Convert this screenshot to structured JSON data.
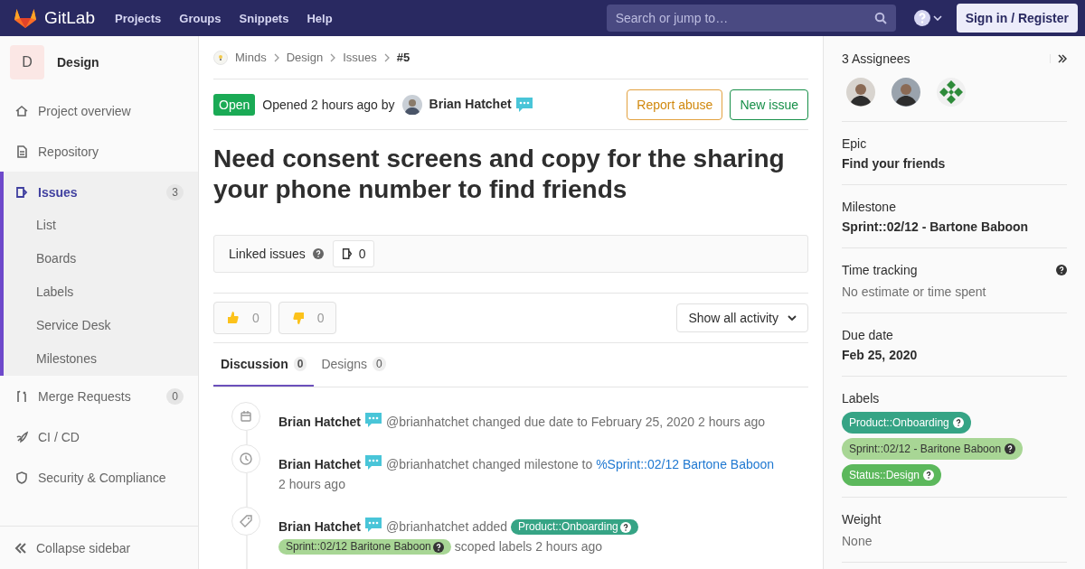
{
  "header": {
    "logo_text": "GitLab",
    "nav": [
      "Projects",
      "Groups",
      "Snippets",
      "Help"
    ],
    "search": {
      "placeholder": "Search or jump to…"
    },
    "sign_in": "Sign in / Register"
  },
  "sidebar": {
    "project_letter": "D",
    "project_name": "Design",
    "items": [
      {
        "label": "Project overview",
        "selected": false
      },
      {
        "label": "Repository",
        "selected": false
      },
      {
        "label": "Issues",
        "selected": true,
        "count": "3",
        "children": [
          {
            "label": "List"
          },
          {
            "label": "Boards"
          },
          {
            "label": "Labels"
          },
          {
            "label": "Service Desk"
          },
          {
            "label": "Milestones"
          }
        ]
      },
      {
        "label": "Merge Requests",
        "selected": false,
        "count": "0"
      },
      {
        "label": "CI / CD",
        "selected": false
      },
      {
        "label": "Security & Compliance",
        "selected": false
      }
    ],
    "collapse": "Collapse sidebar"
  },
  "breadcrumbs": [
    "Minds",
    "Design",
    "Issues",
    "#5"
  ],
  "issue": {
    "status": "Open",
    "opened": "Opened 2 hours ago by",
    "author": "Brian Hatchet",
    "buttons": [
      "Report abuse",
      "New issue"
    ],
    "title": "Need consent screens and copy for the sharing your phone number to find friends",
    "linked": {
      "label": "Linked issues",
      "count": "0"
    },
    "reactions": [
      {
        "kind": "up",
        "count": "0"
      },
      {
        "kind": "down",
        "count": "0"
      }
    ],
    "activity_filter": "Show all activity",
    "tabs": [
      {
        "label": "Discussion",
        "count": "0",
        "selected": true
      },
      {
        "label": "Designs",
        "count": "0",
        "selected": false
      }
    ],
    "events": [
      {
        "kind": "calendar",
        "author": "Brian Hatchet",
        "text": "@brianhatchet changed due date to February 25, 2020 2 hours ago"
      },
      {
        "kind": "clock",
        "author": "Brian Hatchet",
        "text": "@brianhatchet changed milestone to",
        "link": "%Sprint::02/12 Bartone Baboon",
        "after": "2 hours ago"
      },
      {
        "kind": "tag",
        "author": "Brian Hatchet",
        "text": "@brianhatchet added",
        "labels": [
          {
            "text": "Product::Onboarding",
            "color": "#36a485"
          },
          {
            "text": "Sprint::02/12 Baritone Baboon",
            "color": "#a8d695"
          }
        ],
        "after": "scoped labels 2 hours ago"
      }
    ]
  },
  "right": {
    "assignees_title": "3 Assignees",
    "assignees": [
      {
        "kind": "person"
      },
      {
        "kind": "person"
      },
      {
        "kind": "identicon"
      }
    ],
    "epic": {
      "title": "Epic",
      "value": "Find your friends"
    },
    "milestone": {
      "title": "Milestone",
      "value": "Sprint::02/12 - Bartone Baboon"
    },
    "time_tracking": {
      "title": "Time tracking",
      "value": "No estimate or time spent"
    },
    "due_date": {
      "title": "Due date",
      "value": "Feb 25, 2020"
    },
    "labels": {
      "title": "Labels",
      "items": [
        {
          "text": "Product::Onboarding",
          "color": "#36a485"
        },
        {
          "text": "Sprint::02/12 - Baritone Baboon",
          "color": "#a8d695"
        },
        {
          "text": "Status::Design",
          "color": "#5cb85c"
        }
      ]
    },
    "weight": {
      "title": "Weight",
      "value": "None"
    }
  }
}
